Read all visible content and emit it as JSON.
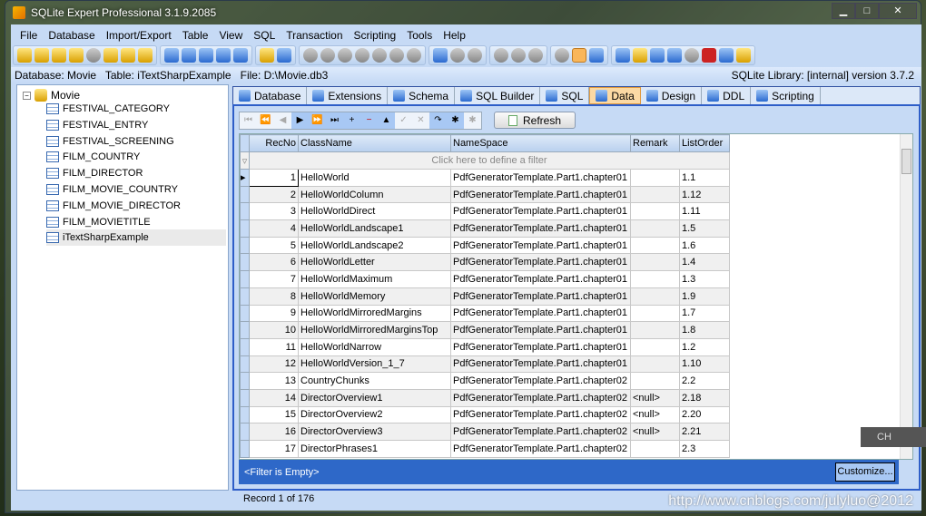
{
  "window": {
    "title": "SQLite Expert Professional 3.1.9.2085",
    "minimize": "▁",
    "maximize": "□",
    "close": "✕"
  },
  "menu": [
    "File",
    "Database",
    "Import/Export",
    "Table",
    "View",
    "SQL",
    "Transaction",
    "Scripting",
    "Tools",
    "Help"
  ],
  "info": {
    "database": "Database: Movie",
    "table": "Table: iTextSharpExample",
    "file": "File: D:\\Movie.db3",
    "library": "SQLite Library: [internal] version 3.7.2"
  },
  "tree": {
    "root": "Movie",
    "items": [
      "FESTIVAL_CATEGORY",
      "FESTIVAL_ENTRY",
      "FESTIVAL_SCREENING",
      "FILM_COUNTRY",
      "FILM_DIRECTOR",
      "FILM_MOVIE_COUNTRY",
      "FILM_MOVIE_DIRECTOR",
      "FILM_MOVIETITLE",
      "iTextSharpExample"
    ],
    "selected": "iTextSharpExample"
  },
  "tabs": [
    "Database",
    "Extensions",
    "Schema",
    "SQL Builder",
    "SQL",
    "Data",
    "Design",
    "DDL",
    "Scripting"
  ],
  "active_tab": "Data",
  "nav_buttons": [
    "⏮",
    "⏪",
    "◀",
    "▶",
    "⏩",
    "⏭",
    "+",
    "−",
    "▲",
    "✓",
    "✕",
    "↷",
    "✱",
    "✱"
  ],
  "refresh_label": "Refresh",
  "grid": {
    "columns": [
      "RecNo",
      "ClassName",
      "NameSpace",
      "Remark",
      "ListOrder"
    ],
    "filter_placeholder": "Click here to define a filter",
    "rows": [
      [
        "1",
        "HelloWorld",
        "PdfGeneratorTemplate.Part1.chapter01",
        "",
        "1.1"
      ],
      [
        "2",
        "HelloWorldColumn",
        "PdfGeneratorTemplate.Part1.chapter01",
        "",
        "1.12"
      ],
      [
        "3",
        "HelloWorldDirect",
        "PdfGeneratorTemplate.Part1.chapter01",
        "",
        "1.11"
      ],
      [
        "4",
        "HelloWorldLandscape1",
        "PdfGeneratorTemplate.Part1.chapter01",
        "",
        "1.5"
      ],
      [
        "5",
        "HelloWorldLandscape2",
        "PdfGeneratorTemplate.Part1.chapter01",
        "",
        "1.6"
      ],
      [
        "6",
        "HelloWorldLetter",
        "PdfGeneratorTemplate.Part1.chapter01",
        "",
        "1.4"
      ],
      [
        "7",
        "HelloWorldMaximum",
        "PdfGeneratorTemplate.Part1.chapter01",
        "",
        "1.3"
      ],
      [
        "8",
        "HelloWorldMemory",
        "PdfGeneratorTemplate.Part1.chapter01",
        "",
        "1.9"
      ],
      [
        "9",
        "HelloWorldMirroredMargins",
        "PdfGeneratorTemplate.Part1.chapter01",
        "",
        "1.7"
      ],
      [
        "10",
        "HelloWorldMirroredMarginsTop",
        "PdfGeneratorTemplate.Part1.chapter01",
        "",
        "1.8"
      ],
      [
        "11",
        "HelloWorldNarrow",
        "PdfGeneratorTemplate.Part1.chapter01",
        "",
        "1.2"
      ],
      [
        "12",
        "HelloWorldVersion_1_7",
        "PdfGeneratorTemplate.Part1.chapter01",
        "",
        "1.10"
      ],
      [
        "13",
        "CountryChunks",
        "PdfGeneratorTemplate.Part1.chapter02",
        "",
        "2.2"
      ],
      [
        "14",
        "DirectorOverview1",
        "PdfGeneratorTemplate.Part1.chapter02",
        "<null>",
        "2.18"
      ],
      [
        "15",
        "DirectorOverview2",
        "PdfGeneratorTemplate.Part1.chapter02",
        "<null>",
        "2.20"
      ],
      [
        "16",
        "DirectorOverview3",
        "PdfGeneratorTemplate.Part1.chapter02",
        "<null>",
        "2.21"
      ],
      [
        "17",
        "DirectorPhrases1",
        "PdfGeneratorTemplate.Part1.chapter02",
        "",
        "2.3"
      ]
    ]
  },
  "filter_status": "<Filter is Empty>",
  "customize_label": "Customize...",
  "status": "Record 1 of 176",
  "ime": "CH",
  "watermark": "http://www.cnblogs.com/julyluo@2012"
}
